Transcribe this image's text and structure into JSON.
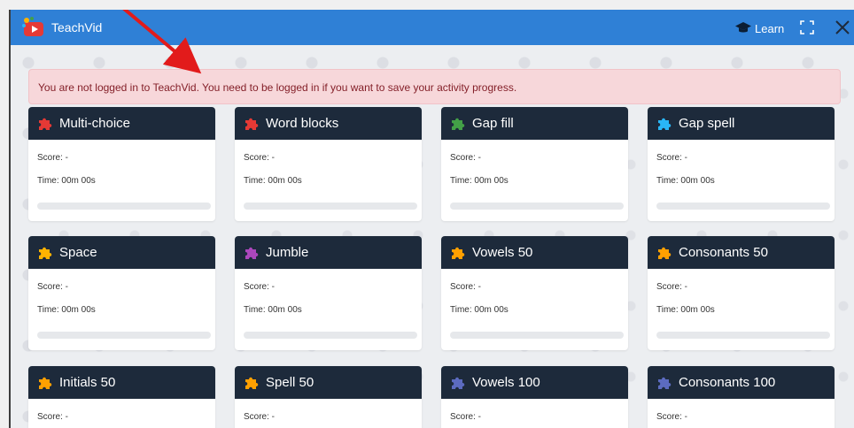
{
  "app": {
    "title": "TeachVid",
    "learn_label": "Learn",
    "icons": {
      "logo": "teachvid-logo-icon",
      "learn": "graduation-cap-icon",
      "fullscreen": "fullscreen-icon",
      "close": "close-icon"
    }
  },
  "alert": {
    "message": "You are not logged in to TeachVid. You need to be logged in if you want to save your activity progress."
  },
  "activities": [
    {
      "title": "Multi-choice",
      "color": "#e53935",
      "score": "Score: -",
      "time": "Time: 00m 00s",
      "progress": 0
    },
    {
      "title": "Word blocks",
      "color": "#e53935",
      "score": "Score: -",
      "time": "Time: 00m 00s",
      "progress": 0
    },
    {
      "title": "Gap fill",
      "color": "#43a047",
      "score": "Score: -",
      "time": "Time: 00m 00s",
      "progress": 0
    },
    {
      "title": "Gap spell",
      "color": "#29b6f6",
      "score": "Score: -",
      "time": "Time: 00m 00s",
      "progress": 0
    },
    {
      "title": "Space",
      "color": "#ffb300",
      "score": "Score: -",
      "time": "Time: 00m 00s",
      "progress": 0
    },
    {
      "title": "Jumble",
      "color": "#ab47bc",
      "score": "Score: -",
      "time": "Time: 00m 00s",
      "progress": 0
    },
    {
      "title": "Vowels 50",
      "color": "#ffa000",
      "score": "Score: -",
      "time": "Time: 00m 00s",
      "progress": 0
    },
    {
      "title": "Consonants 50",
      "color": "#ffa000",
      "score": "Score: -",
      "time": "Time: 00m 00s",
      "progress": 0
    },
    {
      "title": "Initials 50",
      "color": "#ffa000",
      "score": "Score: -",
      "progress": 0
    },
    {
      "title": "Spell 50",
      "color": "#ffa000",
      "score": "Score: -",
      "progress": 0
    },
    {
      "title": "Vowels 100",
      "color": "#5c6bc0",
      "score": "Score: -",
      "progress": 0
    },
    {
      "title": "Consonants 100",
      "color": "#5c6bc0",
      "score": "Score: -",
      "progress": 0
    }
  ],
  "annotation": {
    "arrow_color": "#e21b1b"
  }
}
